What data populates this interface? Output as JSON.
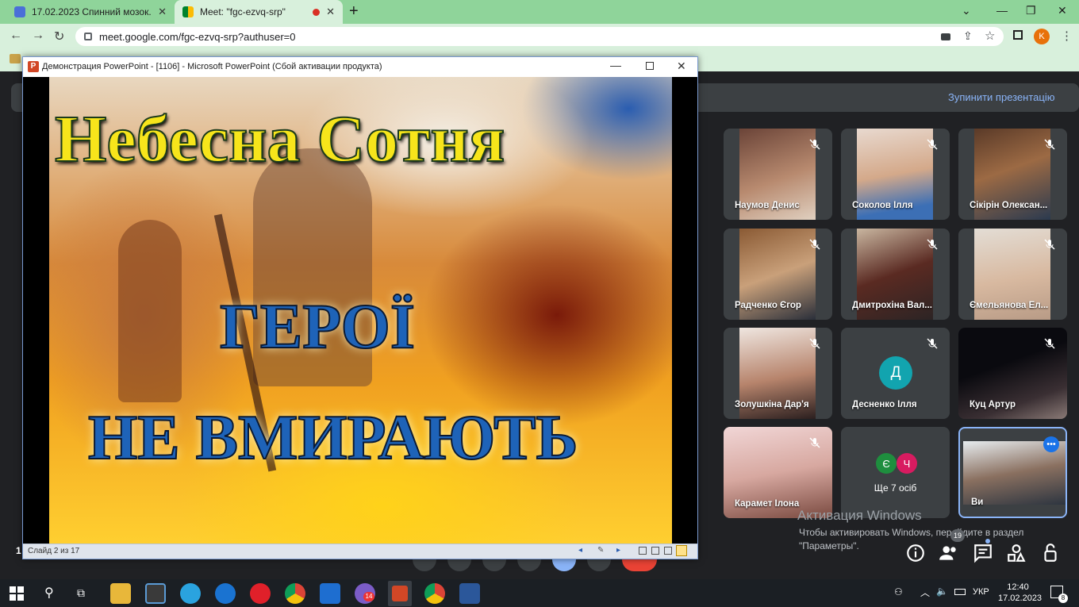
{
  "browser": {
    "tabs": [
      {
        "label": "17.02.2023 Спинний мозок.",
        "active": false,
        "favicon_color": "#4a6fd8"
      },
      {
        "label": "Meet: \"fgc-ezvq-srp\"",
        "active": true,
        "favicon_color": "#00832d"
      }
    ],
    "url": "meet.google.com/fgc-ezvq-srp?authuser=0",
    "profile_initial": "K"
  },
  "meet": {
    "stop_presenting": "Зупинити презентацію",
    "participants": [
      {
        "name": "Наумов Денис",
        "video": true,
        "muted": true
      },
      {
        "name": "Соколов Ілля",
        "video": true,
        "muted": true
      },
      {
        "name": "Сікірін Олексан...",
        "video": true,
        "muted": true
      },
      {
        "name": "Радченко Єгор",
        "video": true,
        "muted": true
      },
      {
        "name": "Дмитрохіна Вал...",
        "video": true,
        "muted": true
      },
      {
        "name": "Ємельянова Ел...",
        "video": true,
        "muted": true
      },
      {
        "name": "Золушкіна Дар'я",
        "video": true,
        "muted": true
      },
      {
        "name": "Десненко Ілля",
        "video": false,
        "initial": "Д",
        "avatar_color": "#12a4af",
        "muted": true
      },
      {
        "name": "Куц Артур",
        "video": true,
        "muted": true
      },
      {
        "name": "Карамет Ілона",
        "video": true,
        "muted": true
      },
      {
        "name": "Ще 7 осіб",
        "video": false,
        "more_initials": [
          "Є",
          "Ч"
        ],
        "more_colors": [
          "#1e8e3e",
          "#d81b60"
        ]
      },
      {
        "name": "Ви",
        "video": true,
        "self": true
      }
    ],
    "participant_count": "19"
  },
  "windows_activation": {
    "title": "Активация Windows",
    "body": "Чтобы активировать Windows, перейдите в раздел \"Параметры\"."
  },
  "powerpoint": {
    "title": "Демонстрация PowerPoint - [1106] - Microsoft PowerPoint (Сбой активации продукта)",
    "slide_status": "Слайд 2 из 17",
    "slide": {
      "line1": "Небесна  Сотня",
      "line2": "ГЕРОЇ",
      "line3": "НЕ  ВМИРАЮТЬ"
    }
  },
  "taskbar": {
    "time": "12:40",
    "date": "17.02.2023",
    "language": "УКР",
    "left_marker": "1",
    "viber_badge": "14",
    "notif_badge": "8"
  }
}
